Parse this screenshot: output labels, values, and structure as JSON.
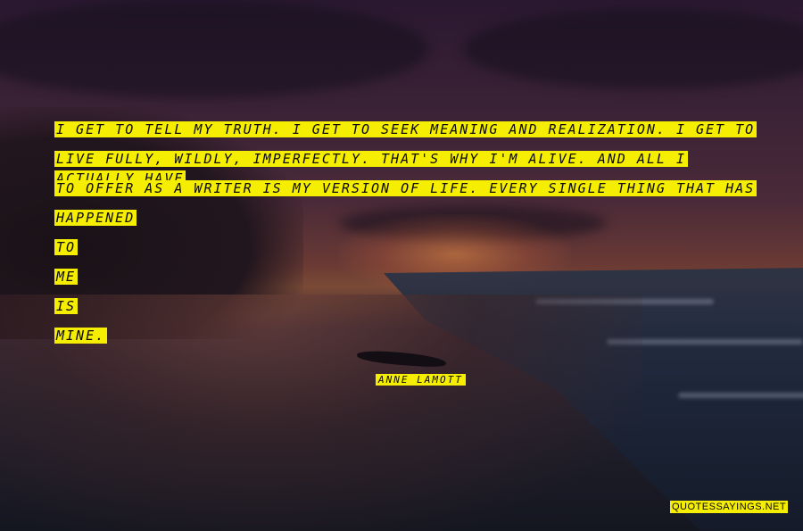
{
  "quote": {
    "lines": [
      "I GET TO TELL MY TRUTH. I GET TO SEEK MEANING AND REALIZATION. I GET TO",
      "LIVE FULLY, WILDLY, IMPERFECTLY. THAT'S WHY I'M ALIVE. AND ALL I ACTUALLY HAVE",
      "TO OFFER AS A WRITER IS MY VERSION OF LIFE. EVERY SINGLE THING THAT HAS",
      "HAPPENED",
      "TO",
      "ME",
      "IS",
      "MINE."
    ],
    "highlight_color": "#f6ee00",
    "text_color": "#0c0a08"
  },
  "author": "ANNE LAMOTT",
  "watermark": "QUOTESSAYINGS.NET"
}
